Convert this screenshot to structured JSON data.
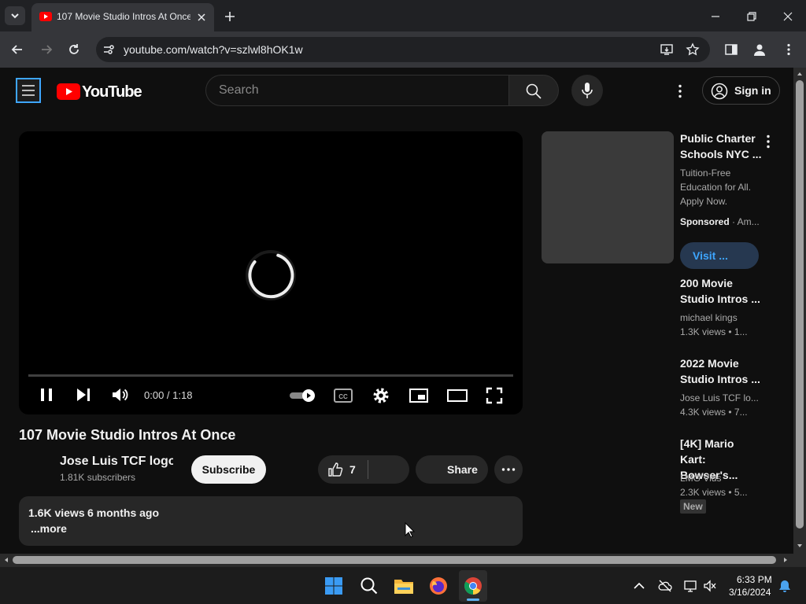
{
  "browser": {
    "tab_title": "107 Movie Studio Intros At Once",
    "url": "youtube.com/watch?v=szlwl8hOK1w"
  },
  "header": {
    "logo_text": "YouTube",
    "search_placeholder": "Search",
    "signin_label": "Sign in"
  },
  "player": {
    "time": "0:00 / 1:18",
    "progress_fraction": 0
  },
  "video": {
    "title": "107 Movie Studio Intros At Once",
    "channel": "Jose Luis TCF logo r",
    "subscribers": "1.81K subscribers",
    "subscribe_label": "Subscribe",
    "likes": "7",
    "share_label": "Share",
    "views": "1.6K views",
    "date": "6 months ago",
    "more_label": "...more"
  },
  "sidebar": {
    "ad": {
      "title": "Public Charter Schools NYC ...",
      "description": "Tuition-Free Education for All. Apply Now.",
      "sponsored": "Sponsored",
      "advertiser": " · Am...",
      "visit_label": "Visit ..."
    },
    "items": [
      {
        "title": "200 Movie Studio Intros ...",
        "channel": "michael kings",
        "stats": "1.3K views  • 1..."
      },
      {
        "title": "2022 Movie Studio Intros ...",
        "channel": "Jose Luis TCF lo...",
        "stats": "4.3K views  • 7..."
      },
      {
        "title": "[4K] Mario Kart: Bowser's...",
        "channel": "LMG Vids",
        "stats": "2.3K views  • 5...",
        "badge": "New"
      }
    ]
  },
  "taskbar": {
    "time": "6:33 PM",
    "date": "3/16/2024"
  },
  "colors": {
    "youtube_red": "#ff0000",
    "background": "#0f0f0f",
    "link_blue": "#3ea6ff"
  }
}
